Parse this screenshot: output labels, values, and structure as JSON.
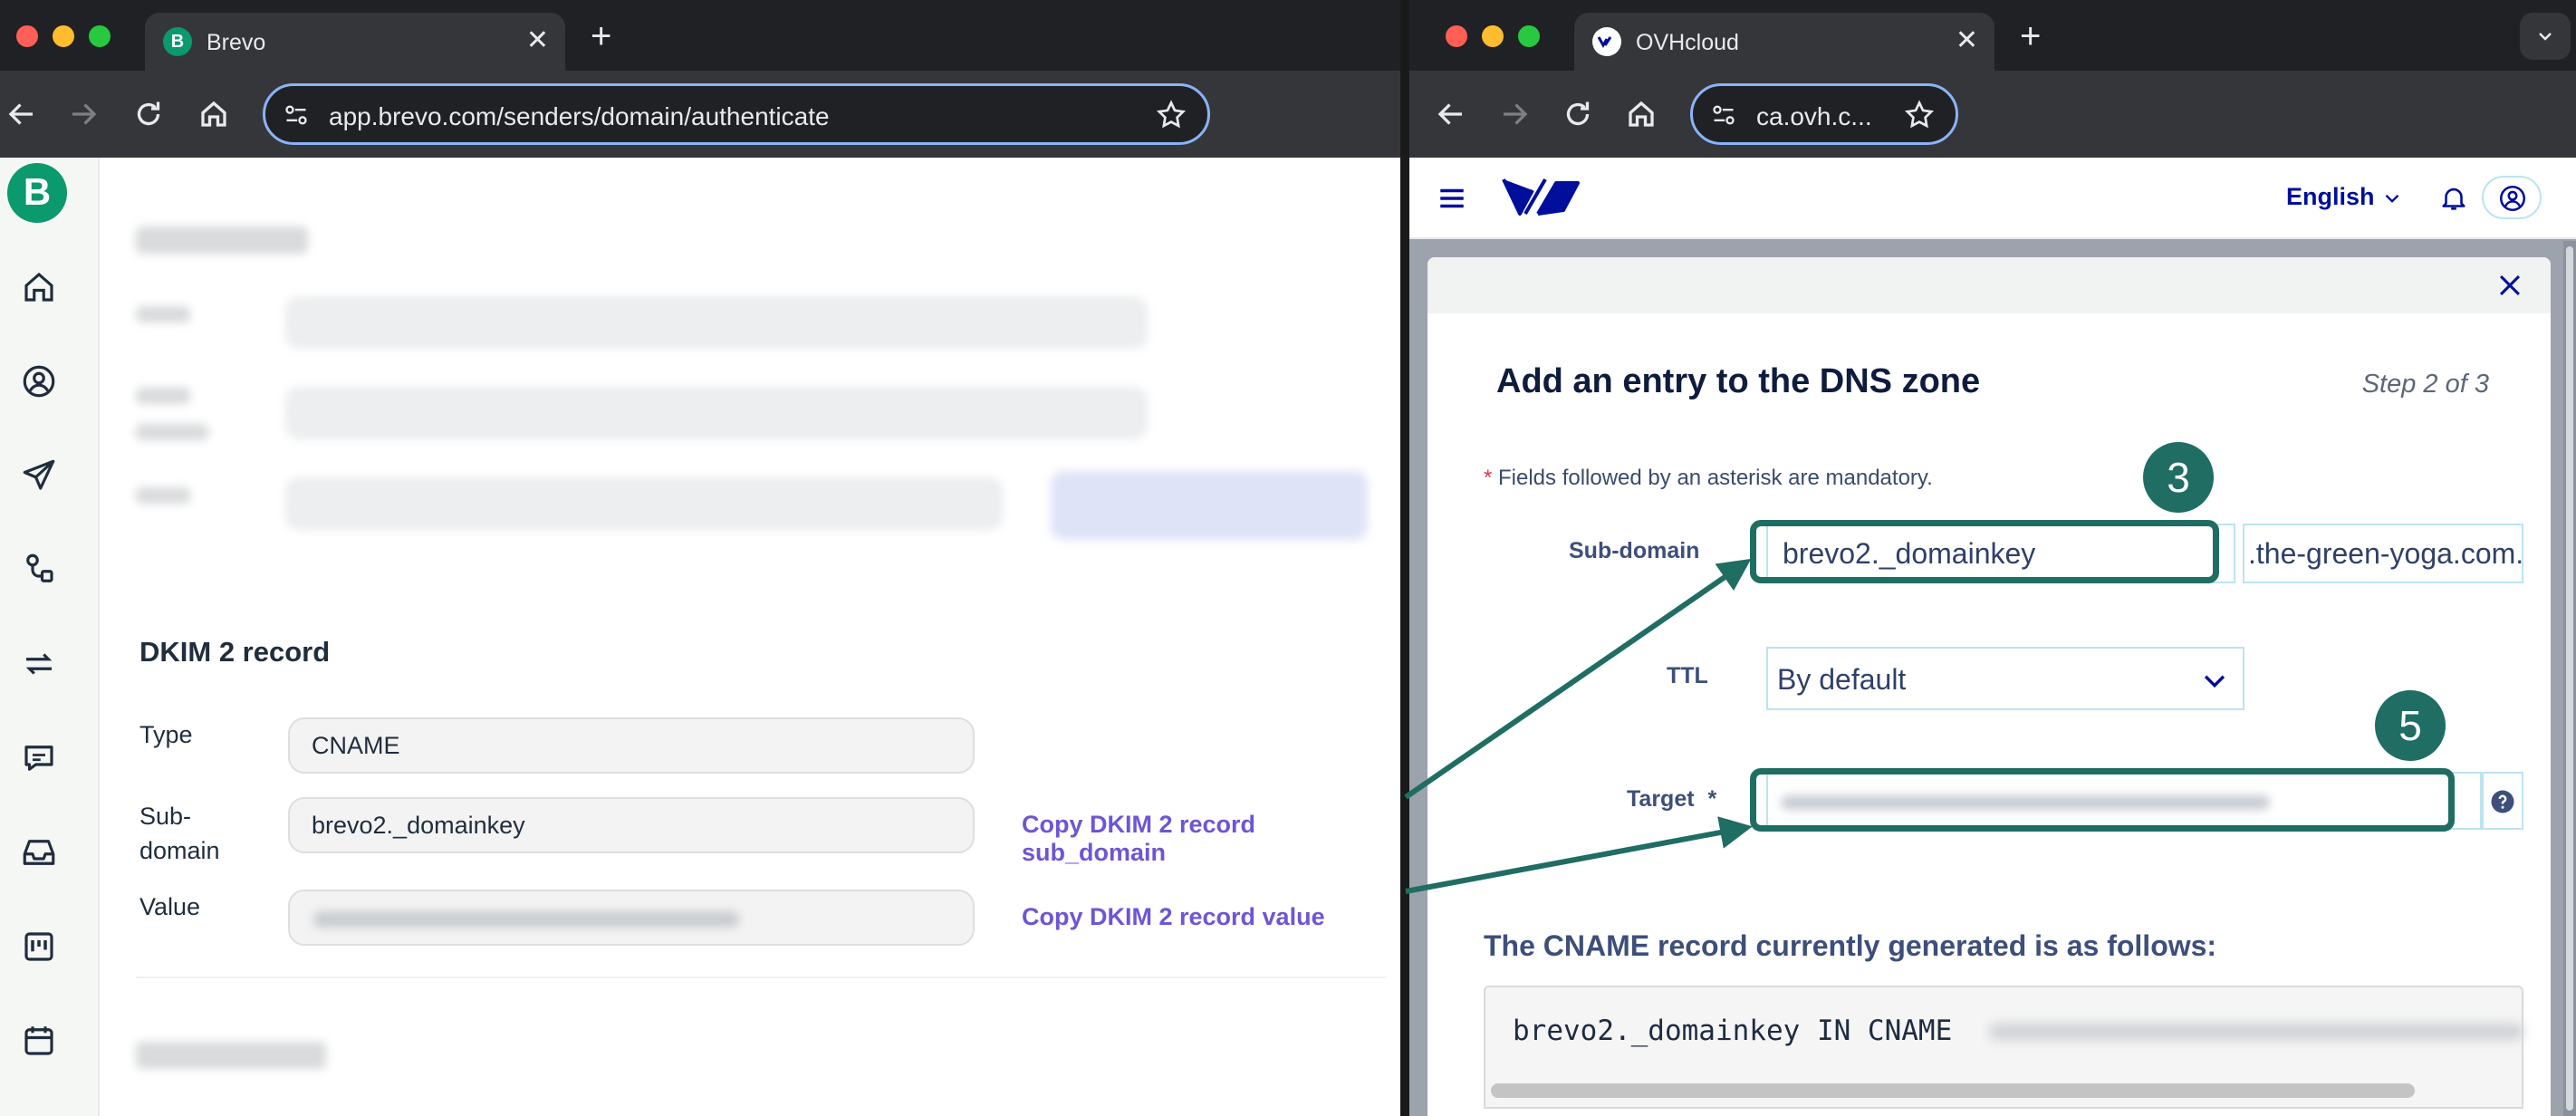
{
  "left_browser": {
    "tab_title": "Brevo",
    "tab_favicon": "B",
    "url": "app.brevo.com/senders/domain/authenticate"
  },
  "right_browser": {
    "tab_title": "OVHcloud",
    "url": "ca.ovh.c..."
  },
  "brevo": {
    "logo": "B",
    "sidebar_icons": [
      "home-icon",
      "contacts-icon",
      "campaigns-send-icon",
      "automations-icon",
      "transactional-icon",
      "conversations-icon",
      "inbox-icon",
      "deals-board-icon",
      "calendar-icon"
    ],
    "dkim2": {
      "title": "DKIM 2 record",
      "type_label": "Type",
      "type_value": "CNAME",
      "subdomain_label_1": "Sub-",
      "subdomain_label_2": "domain",
      "subdomain_value": "brevo2._domainkey",
      "value_label": "Value",
      "copy_subdomain": "Copy DKIM 2 record sub_domain",
      "copy_value": "Copy DKIM 2 record value"
    }
  },
  "ovh": {
    "language": "English",
    "modal": {
      "title": "Add an entry to the DNS zone",
      "step": "Step 2 of 3",
      "mandatory_star": "*",
      "mandatory_note": " Fields followed by an asterisk are mandatory.",
      "subdomain_label": "Sub-domain",
      "subdomain_value": "brevo2._domainkey",
      "subdomain_suffix": ".the-green-yoga.com.",
      "ttl_label": "TTL",
      "ttl_value": "By default",
      "target_label": "Target",
      "target_star": "*",
      "cname_title": "The CNAME record currently generated is as follows:",
      "cname_value": "brevo2._domainkey IN CNAME"
    },
    "badges": {
      "subdomain": "3",
      "target": "5"
    }
  },
  "colors": {
    "annotation": "#1f6d63",
    "brevo_green": "#0b996e",
    "copy_link": "#6a57d6",
    "ovh_blue": "#000e9c"
  }
}
